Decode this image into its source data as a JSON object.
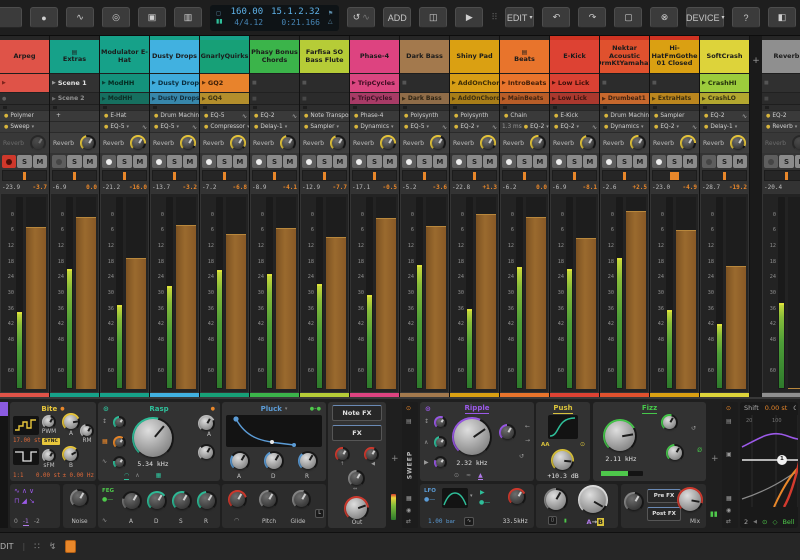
{
  "toolbar": {
    "tempo": "160.00",
    "time_sig": "4/4.12",
    "position": "15.1.2.32",
    "time": "0:21.166",
    "add": "ADD",
    "edit": "EDIT",
    "device": "DEVICE",
    "help": "?"
  },
  "icons": {
    "record": "●",
    "automation": "∿",
    "cue": "◎",
    "dual_view": "▣",
    "mixer_view": "▥",
    "stop": "◻",
    "meter_bars": "▮▮",
    "metro": "△",
    "punch_in": "⚑",
    "punch_out": "⚑",
    "loop": "↺",
    "swing": "∿",
    "save": "◫",
    "play": "▶",
    "caret": "▾",
    "undo": "↶",
    "redo": "↷",
    "copy": "▢",
    "delete": "⊗",
    "panel": "◧",
    "grip": "⠿",
    "power": "⊙",
    "folder_sm": "▤",
    "plus": "+",
    "updown": "↕",
    "wave": "∿",
    "tri": "∧",
    "arc": "◠",
    "left": "←",
    "right": "→",
    "loop_sm": "↺",
    "phase": "Ø",
    "approx": "≈",
    "flame": "▲",
    "comb": "▦",
    "speaker": "◀",
    "swap": "⇄",
    "target": "◉",
    "pause": "▮▮",
    "diamond": "◇",
    "up": "↑",
    "mono_width": "⇔",
    "toggle": "●–●",
    "ramp": "▶",
    "dots": "⠿"
  },
  "mixer": {
    "send_label": "Reverb",
    "solo": "S",
    "mute": "M",
    "add_track": "+",
    "scale": [
      "0",
      "6",
      "12",
      "18",
      "24",
      "30",
      "36",
      "42",
      "48",
      "60"
    ]
  },
  "tracks": [
    {
      "name": "Arpeg",
      "hc": "#df5348",
      "band": "",
      "folder": "",
      "kind": "",
      "c1": {
        "t": "",
        "bg": "#df5348",
        "g": "▶",
        "gc": "#7e241d",
        "tc": "#2b0d0a"
      },
      "c2": {
        "t": "",
        "bg": "#2c2c2c",
        "g": "●",
        "gc": "#6a6a6a",
        "tc": "#aaaaaa"
      },
      "d1": {
        "dot": "●",
        "n": "Polymer"
      },
      "d2": {
        "dot": "●",
        "n": "Sweep",
        "suf": "▾"
      },
      "send": {
        "a": "0deg",
        "st": "dim"
      },
      "rec": "armed",
      "pan": "3px",
      "mdb": "-23.9",
      "fdb": "-3.7"
    },
    {
      "name": "Extras",
      "hc": "#16a189",
      "band": "",
      "folder": "▤",
      "kind": "",
      "c1": {
        "t": "Scene 1",
        "bg": "#323232",
        "g": "▶",
        "gc": "#9a9a9a",
        "tc": "#e2e2e2"
      },
      "c2": {
        "t": "Scene 2",
        "bg": "#2b2b2b",
        "g": "▶",
        "gc": "#7e7e7e",
        "tc": "#a8a8a8"
      },
      "d1": {
        "dot": "",
        "n": "+"
      },
      "d2": {
        "dot": "",
        "n": ""
      },
      "send": {
        "a": "120deg",
        "st": ""
      },
      "rec": "dim",
      "pan": "3px",
      "mdb": "-6.9",
      "fdb": "0.0"
    },
    {
      "name": "Modulator E-Hat",
      "hc": "#16a189",
      "band": "#16a189",
      "folder": "",
      "kind": "",
      "c1": {
        "t": "ModHH",
        "bg": "#14927c",
        "g": "▶",
        "gc": "#083f34",
        "tc": "#04291f"
      },
      "c2": {
        "t": "ModHH",
        "bg": "#107c69",
        "g": "▶",
        "gc": "#083f34",
        "tc": "#04291f"
      },
      "d1": {
        "dot": "●",
        "n": "E-Hat"
      },
      "d2": {
        "dot": "●",
        "n": "EQ-5",
        "suf": "▾",
        "crv": "∿"
      },
      "send": {
        "a": "230deg",
        "st": ""
      },
      "rec": "on",
      "pan": "3px",
      "mdb": "-21.2",
      "fdb": "-16.0"
    },
    {
      "name": "Dusty Drops",
      "hc": "#41b1e0",
      "band": "#16a189",
      "folder": "",
      "kind": "",
      "c1": {
        "t": "Dusty Drops",
        "bg": "#3fabdb",
        "g": "▶",
        "gc": "#0d3c52",
        "tc": "#0a2c3d"
      },
      "c2": {
        "t": "Dusty Drops",
        "bg": "#3899c4",
        "g": "▶",
        "gc": "#0d3c52",
        "tc": "#0a2c3d"
      },
      "d1": {
        "dot": "●",
        "n": "Drum Machine"
      },
      "d2": {
        "dot": "●",
        "n": "EQ-5",
        "suf": "▾",
        "crv": "∿"
      },
      "send": {
        "a": "250deg",
        "st": ""
      },
      "rec": "on",
      "pan": "3px",
      "mdb": "-13.7",
      "fdb": "-3.2"
    },
    {
      "name": "GnarlyQuirks",
      "hc": "#17a077",
      "band": "#16a189",
      "folder": "",
      "kind": "",
      "c1": {
        "t": "GQ2",
        "bg": "#e8832c",
        "g": "▶",
        "gc": "#5c2e0a",
        "tc": "#3a1d08"
      },
      "c2": {
        "t": "GQ4",
        "bg": "#cfa22b",
        "g": "▶",
        "gc": "#54400c",
        "tc": "#3a2d08"
      },
      "d1": {
        "dot": "●",
        "n": "EQ-5",
        "crv": "∿"
      },
      "d2": {
        "dot": "●",
        "n": "Compressor",
        "suf": "▾"
      },
      "send": {
        "a": "255deg",
        "st": ""
      },
      "rec": "on",
      "pan": "3px",
      "mdb": "-7.2",
      "fdb": "-6.8"
    },
    {
      "name": "Phasy Bonus Chords",
      "hc": "#3bb44a",
      "band": "",
      "folder": "",
      "kind": "",
      "c1": {
        "t": "",
        "bg": "#2c2c2c",
        "g": "■",
        "gc": "#555555",
        "tc": "#aaaaaa"
      },
      "c2": {
        "t": "",
        "bg": "#2a2a2a",
        "g": "■",
        "gc": "#4d4d4d",
        "tc": "#aaaaaa"
      },
      "d1": {
        "dot": "●",
        "n": "EQ-2",
        "crv": "∿"
      },
      "d2": {
        "dot": "●",
        "n": "Delay-1",
        "suf": "▾"
      },
      "send": {
        "a": "120deg",
        "st": ""
      },
      "rec": "on",
      "pan": "3px",
      "mdb": "-8.9",
      "fdb": "-4.1"
    },
    {
      "name": "Farfisa SO Bass Flute",
      "hc": "#b6cc37",
      "band": "",
      "folder": "",
      "kind": "",
      "c1": {
        "t": "",
        "bg": "#2c2c2c",
        "g": "■",
        "gc": "#555555",
        "tc": "#aaaaaa"
      },
      "c2": {
        "t": "",
        "bg": "#2a2a2a",
        "g": "■",
        "gc": "#4d4d4d",
        "tc": "#aaaaaa"
      },
      "d1": {
        "dot": "●",
        "n": "Note Transpose"
      },
      "d2": {
        "dot": "●",
        "n": "Sampler",
        "suf": "▾"
      },
      "send": {
        "a": "115deg",
        "st": ""
      },
      "rec": "on",
      "pan": "3px",
      "mdb": "-12.9",
      "fdb": "-7.7"
    },
    {
      "name": "Phase-4",
      "hc": "#dd4380",
      "band": "",
      "folder": "",
      "kind": "",
      "c1": {
        "t": "TripCycles",
        "bg": "#da4680",
        "g": "▶",
        "gc": "#4e1029",
        "tc": "#3c0c20"
      },
      "c2": {
        "t": "TripCycles",
        "bg": "#c23d72",
        "g": "▶",
        "gc": "#4e1029",
        "tc": "#3c0c20"
      },
      "d1": {
        "dot": "●",
        "n": "Phase-4"
      },
      "d2": {
        "dot": "●",
        "n": "Dynamics",
        "suf": "▾"
      },
      "send": {
        "a": "230deg",
        "st": ""
      },
      "rec": "on",
      "pan": "3px",
      "mdb": "-17.1",
      "fdb": "-0.5"
    },
    {
      "name": "Dark Bass",
      "hc": "#a3794d",
      "band": "",
      "folder": "",
      "kind": "",
      "c1": {
        "t": "",
        "bg": "#2c2c2c",
        "g": "■",
        "gc": "#555555",
        "tc": "#aaaaaa"
      },
      "c2": {
        "t": "Dark Bass",
        "bg": "#a3794d",
        "g": "▶",
        "gc": "#3a2a12",
        "tc": "#2c200d"
      },
      "d1": {
        "dot": "●",
        "n": "Polysynth"
      },
      "d2": {
        "dot": "●",
        "n": "EQ-5",
        "suf": "▾",
        "crv": "∿"
      },
      "send": {
        "a": "160deg",
        "st": ""
      },
      "rec": "on",
      "pan": "3px",
      "mdb": "-5.2",
      "fdb": "-3.6"
    },
    {
      "name": "Shiny Pad",
      "hc": "#daa012",
      "band": "",
      "folder": "",
      "kind": "",
      "c1": {
        "t": "AddOnChord",
        "bg": "#d79d15",
        "g": "▶",
        "gc": "#4e3906",
        "tc": "#3d2c06"
      },
      "c2": {
        "t": "AddOnChord",
        "bg": "#c28d13",
        "g": "▶",
        "gc": "#4e3906",
        "tc": "#3d2c06"
      },
      "d1": {
        "dot": "●",
        "n": "Polysynth"
      },
      "d2": {
        "dot": "●",
        "n": "EQ-2",
        "suf": "▾",
        "crv": "∿"
      },
      "send": {
        "a": "245deg",
        "st": ""
      },
      "rec": "on",
      "pan": "3px",
      "mdb": "-22.8",
      "fdb": "+1.3"
    },
    {
      "name": "Beats",
      "hc": "#e8742c",
      "band": "",
      "folder": "▤",
      "kind": "",
      "c1": {
        "t": "IntroBeats",
        "bg": "#e8742c",
        "g": "▶",
        "gc": "#54260a",
        "tc": "#401d08"
      },
      "c2": {
        "t": "MainBeats",
        "bg": "#d56726",
        "g": "▶",
        "gc": "#54260a",
        "tc": "#401d08"
      },
      "d1": {
        "dot": "●",
        "n": "Chain"
      },
      "d2": {
        "pre": "1.3 ms",
        "dot": "●",
        "n": "EQ-2",
        "suf": "▾"
      },
      "send": {
        "a": "140deg",
        "st": ""
      },
      "rec": "on",
      "pan": "3px",
      "mdb": "-6.2",
      "fdb": "0.0"
    },
    {
      "name": "E-Kick",
      "hc": "#dd4233",
      "band": "#cf3322",
      "folder": "",
      "kind": "",
      "c1": {
        "t": "Low Lick",
        "bg": "#da4133",
        "g": "▶",
        "gc": "#4c110a",
        "tc": "#3b0e08"
      },
      "c2": {
        "t": "Low Lick",
        "bg": "#c43a2d",
        "g": "▶",
        "gc": "#4c110a",
        "tc": "#3b0e08"
      },
      "d1": {
        "dot": "●",
        "n": "E-Kick"
      },
      "d2": {
        "dot": "●",
        "n": "EQ-2",
        "suf": "▾",
        "crv": "∿"
      },
      "send": {
        "a": "120deg",
        "st": ""
      },
      "rec": "on",
      "pan": "3px",
      "mdb": "-6.9",
      "fdb": "-8.1"
    },
    {
      "name": "Nektar Acoustic DrmKtYamaha2",
      "hc": "#e0512e",
      "band": "#cf3322",
      "folder": "",
      "kind": "",
      "c1": {
        "t": "",
        "bg": "#2c2c2c",
        "g": "■",
        "gc": "#555555",
        "tc": "#aaaaaa"
      },
      "c2": {
        "t": "Drumbeat1",
        "bg": "#e8742c",
        "g": "▶",
        "gc": "#54260a",
        "tc": "#401d08"
      },
      "d1": {
        "dot": "●",
        "n": "Drum Machine"
      },
      "d2": {
        "dot": "●",
        "n": "Dynamics",
        "suf": "▾"
      },
      "send": {
        "a": "140deg",
        "st": ""
      },
      "rec": "on",
      "pan": "3px",
      "mdb": "-2.6",
      "fdb": "+2.5"
    },
    {
      "name": "Hi-HatFmGothe 01 Closed",
      "hc": "#daa012",
      "band": "#cf3322",
      "folder": "",
      "kind": "",
      "c1": {
        "t": "",
        "bg": "#2c2c2c",
        "g": "■",
        "gc": "#555555",
        "tc": "#aaaaaa"
      },
      "c2": {
        "t": "ExtraHats",
        "bg": "#d9991a",
        "g": "▶",
        "gc": "#4e3906",
        "tc": "#3d2c06"
      },
      "d1": {
        "dot": "●",
        "n": "Sampler"
      },
      "d2": {
        "dot": "●",
        "n": "EQ-2",
        "suf": "▾",
        "crv": "∿"
      },
      "send": {
        "a": "225deg",
        "st": ""
      },
      "rec": "on",
      "pan": "9px",
      "mdb": "-23.0",
      "fdb": "-4.9"
    },
    {
      "name": "SoftCrash",
      "hc": "#ddd33a",
      "band": "",
      "folder": "",
      "kind": "",
      "c1": {
        "t": "CrashHI",
        "bg": "#9ccc3c",
        "g": "▶",
        "gc": "#2c3d0d",
        "tc": "#22300b"
      },
      "c2": {
        "t": "CrashLO",
        "bg": "#cfc12f",
        "g": "▶",
        "gc": "#45400c",
        "tc": "#35310a"
      },
      "d1": {
        "dot": "●",
        "n": "EQ-2",
        "crv": "∿"
      },
      "d2": {
        "dot": "●",
        "n": "Delay-1",
        "suf": "▾"
      },
      "send": {
        "a": "250deg",
        "st": ""
      },
      "rec": "dim",
      "pan": "3px",
      "mdb": "-28.7",
      "fdb": "-19.2"
    },
    {
      "name": "Reverb",
      "hc": "#8f8f8f",
      "band": "",
      "folder": "",
      "kind": "return",
      "c1": {
        "t": "",
        "bg": "#303030",
        "g": "■",
        "gc": "#555555",
        "tc": "#aaaaaa"
      },
      "c2": {
        "t": "",
        "bg": "#2a2a2a",
        "g": "■",
        "gc": "#4d4d4d",
        "tc": "#aaaaaa"
      },
      "d1": {
        "dot": "●",
        "n": "EQ-2",
        "crv": "∿"
      },
      "d2": {
        "dot": "●",
        "n": "Reverb",
        "suf": "▾"
      },
      "send": {
        "a": "0deg",
        "st": "dim"
      },
      "rec": "dim",
      "pan": "3px",
      "mdb": "-20.4",
      "fdb": ""
    }
  ],
  "device_panel": {
    "bite": {
      "title": "Bite",
      "pwm": "PWM",
      "a": "A",
      "b": "B",
      "rm": "RM",
      "sfm": "sFM",
      "pitch": "17.00 st",
      "sync": "SYNC",
      "ratio": "1:1",
      "fine": "0.00 st",
      "hz": "± 0.00 Hz"
    },
    "rasp": {
      "title": "Rasp",
      "freq": "5.34 kHz",
      "a": "A"
    },
    "osc_sel": {
      "o0": "0",
      "o1": "-1",
      "o2": "-2"
    },
    "noise": {
      "label": "Noise"
    },
    "feg": {
      "label": "FEG",
      "a": "A",
      "d": "D",
      "s": "S",
      "r": "R"
    },
    "pluck": {
      "title": "Pluck",
      "a": "A",
      "d": "D",
      "r": "R"
    },
    "fx_col": {
      "note_fx": "Note FX",
      "fx": "FX",
      "out": "Out"
    },
    "mono": {
      "pitch": "Pitch",
      "glide": "Glide",
      "l": "L"
    },
    "sweep": {
      "label": "SWEEP"
    },
    "ripple": {
      "title": "Ripple",
      "freq": "2.32 kHz"
    },
    "push": {
      "title": "Push",
      "aa": "AA",
      "gain": "+10.3 dB"
    },
    "fizz": {
      "title": "Fizz",
      "freq": "2.11 kHz"
    },
    "lfo": {
      "label": "LFO",
      "rate": "1.00",
      "unit": "bar",
      "freq": "33.5kHz"
    },
    "ab": {
      "a": "A",
      "arrow": "→",
      "b": "B"
    },
    "mix": {
      "pre": "Pre FX",
      "post": "Post FX",
      "label": "Mix"
    },
    "eq": {
      "shift": "Shift",
      "shift_val": "0.00 st",
      "gain": "Ga",
      "f1": "20",
      "f2": "100",
      "band": "2",
      "type": "Bell",
      "handle": "1"
    }
  },
  "statusbar": {
    "edit": "EDIT"
  }
}
